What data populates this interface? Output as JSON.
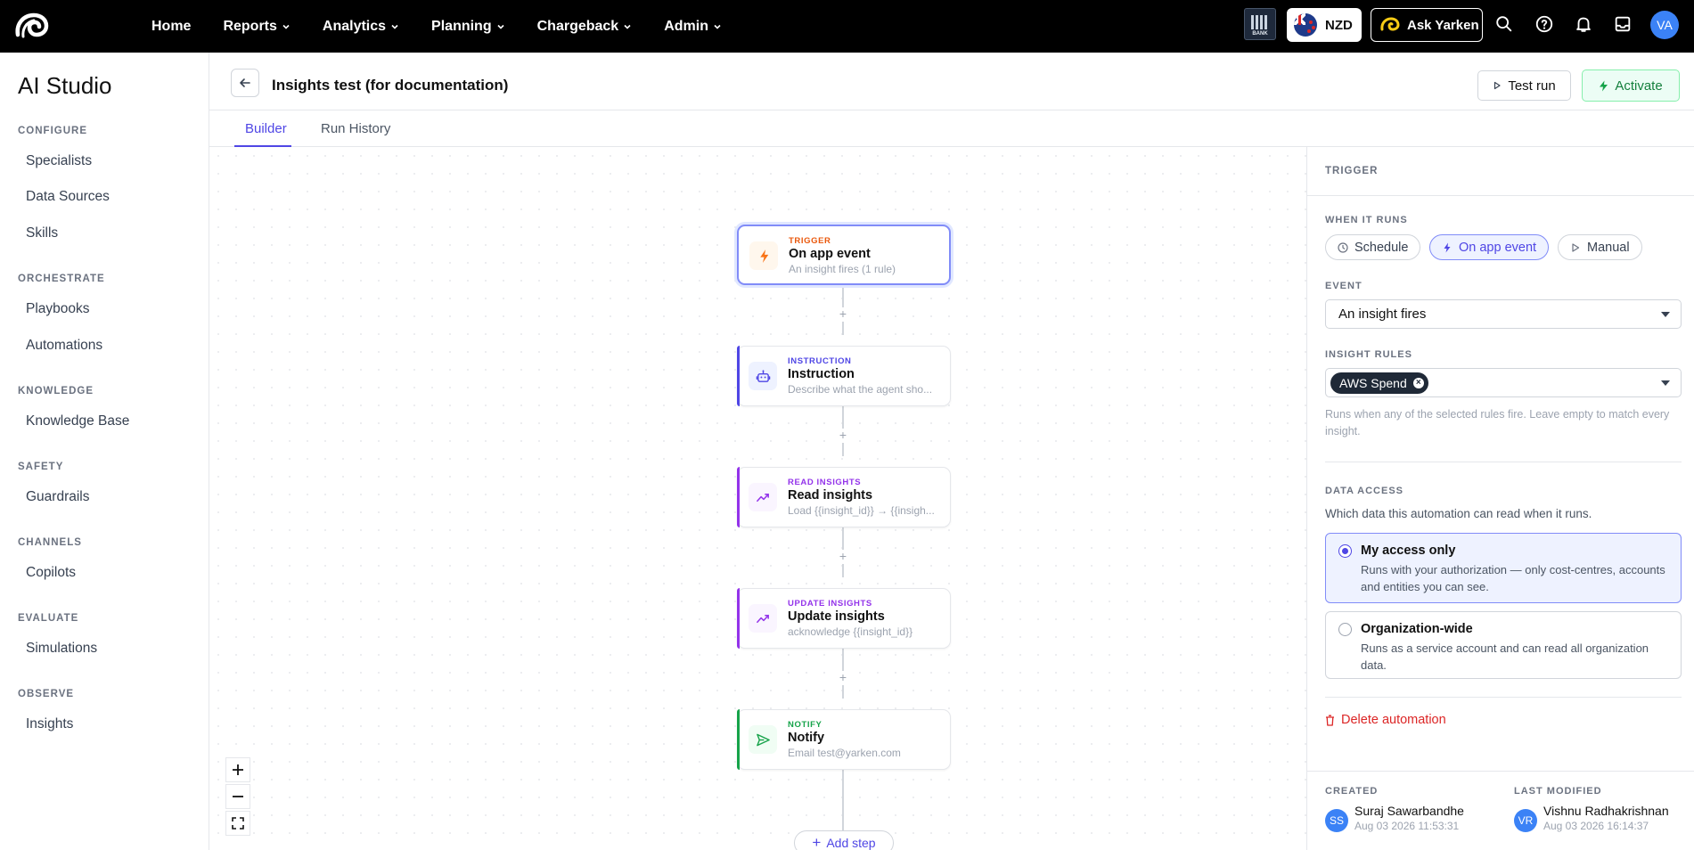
{
  "nav": {
    "items": [
      "Home",
      "Reports",
      "Analytics",
      "Planning",
      "Chargeback",
      "Admin"
    ],
    "bank_label": "BANK",
    "currency": "NZD",
    "ask_label": "Ask Yarken",
    "avatar_initials": "VA"
  },
  "sidebar": {
    "title": "AI Studio",
    "sections": {
      "configure": "CONFIGURE",
      "orchestrate": "ORCHESTRATE",
      "knowledge": "KNOWLEDGE",
      "safety": "SAFETY",
      "channels": "CHANNELS",
      "evaluate": "EVALUATE",
      "observe": "OBSERVE"
    },
    "items": {
      "specialists": "Specialists",
      "data_sources": "Data Sources",
      "skills": "Skills",
      "playbooks": "Playbooks",
      "automations": "Automations",
      "knowledge_base": "Knowledge Base",
      "guardrails": "Guardrails",
      "copilots": "Copilots",
      "simulations": "Simulations",
      "insights": "Insights"
    }
  },
  "header": {
    "title": "Insights test (for documentation)",
    "test_run": "Test run",
    "activate": "Activate"
  },
  "tabs": {
    "builder": "Builder",
    "run_history": "Run History"
  },
  "flow": {
    "nodes": [
      {
        "type": "TRIGGER",
        "title": "On app event",
        "subtitle": "An insight fires (1 rule)",
        "icon": "bolt-icon"
      },
      {
        "type": "INSTRUCTION",
        "title": "Instruction",
        "subtitle": "Describe what the agent sho...",
        "icon": "robot-icon"
      },
      {
        "type": "READ INSIGHTS",
        "title": "Read insights",
        "subtitle": "Load {{insight_id}} → {{insigh...",
        "icon": "trend-icon"
      },
      {
        "type": "UPDATE INSIGHTS",
        "title": "Update insights",
        "subtitle": "acknowledge {{insight_id}}",
        "icon": "trend-icon"
      },
      {
        "type": "NOTIFY",
        "title": "Notify",
        "subtitle": "Email test@yarken.com",
        "icon": "send-icon"
      }
    ],
    "add_step": "Add step",
    "plus_glyph": "+"
  },
  "colors": {
    "trigger": "#ea580c",
    "instruction": "#4f46e5",
    "insights": "#9333ea",
    "notify": "#16a34a",
    "accent": "#4f46e5",
    "danger": "#dc2626"
  },
  "panel": {
    "heading": "TRIGGER",
    "when_label": "WHEN IT RUNS",
    "when_options": {
      "schedule": "Schedule",
      "app_event": "On app event",
      "manual": "Manual"
    },
    "event_label": "EVENT",
    "event_value": "An insight fires",
    "rules_label": "INSIGHT RULES",
    "rule_chip": "AWS Spend",
    "rules_help": "Runs when any of the selected rules fire. Leave empty to match every insight.",
    "data_access_label": "DATA ACCESS",
    "data_access_help": "Which data this automation can read when it runs.",
    "access_options": {
      "mine": {
        "title": "My access only",
        "desc": "Runs with your authorization — only cost-centres, accounts and entities you can see."
      },
      "org": {
        "title": "Organization-wide",
        "desc": "Runs as a service account and can read all organization data."
      }
    },
    "delete_label": "Delete automation",
    "created_label": "CREATED",
    "created_by": "Suraj Sawarbandhe",
    "created_initials": "SS",
    "created_at": "Aug 03 2026 11:53:31",
    "modified_label": "LAST MODIFIED",
    "modified_by": "Vishnu Radhakrishnan",
    "modified_initials": "VR",
    "modified_at": "Aug 03 2026 16:14:37"
  }
}
